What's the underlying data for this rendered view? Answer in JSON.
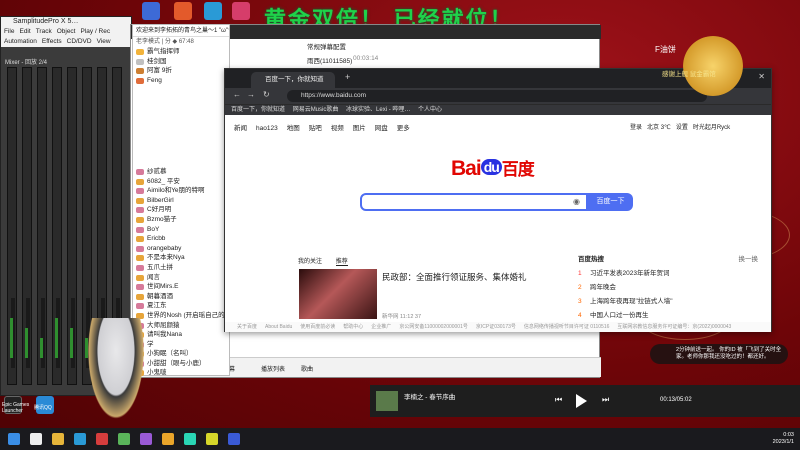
{
  "banner": {
    "text": "黄金双倍！ 已经就位！"
  },
  "daw": {
    "title": "SamplitudePro X 5…",
    "menu": [
      "File",
      "Edit",
      "Track",
      "Object",
      "Play / Rec",
      "Automation",
      "Effects",
      "CD/DVD",
      "View",
      "Ta…"
    ],
    "mixer_label": "Mixer - 回放 2/4"
  },
  "chat": {
    "header": "欢迎来到李拓拓的青鸟之巢～1 \"ω\"♡",
    "count1": "40717173",
    "count2": "457",
    "rank_label": "老李模式 | 分  ◆ 67:48",
    "top": [
      {
        "n": "1",
        "name": "霸气指挥师"
      },
      {
        "n": "2",
        "name": "桂剑国"
      },
      {
        "n": "3",
        "name": "阿富 9折"
      },
      {
        "n": "4",
        "name": "Feng"
      }
    ],
    "users": [
      "纱贰慕",
      "6082_ 平安",
      "Aimilo和Ye朋的特啊",
      "BilberGirl",
      "C好月明",
      "Bzmo猫子",
      "BoY",
      "Ericbb",
      "orangebaby",
      "不是本来Nya",
      "五爪土拼",
      "闻言",
      "世间Mirs.E",
      "朝暮酒酒",
      "夏江东",
      "世界的Nosh (开启瑶自己的)",
      "大师屈颜猿",
      "请叫我Nana",
      "学",
      "小狗眠（名叫）",
      "小甜甜（眼与小鹿）",
      "小鬼啵"
    ]
  },
  "obs": {
    "panel_title": "常规弹幕配置",
    "panel_item": "雨西(11011585)",
    "panel_time": "00:03:14",
    "bottom_items": [
      "帧日弹幕",
      "播放列表",
      "歌曲"
    ]
  },
  "browser": {
    "tab_title": "百度一下，你就知道",
    "url": "https://www.baidu.com",
    "bookmarks": [
      "百度一下，你就知道",
      "网易云Music歌曲",
      "冰球实验、Lexi - 哔哩…",
      "个人中心"
    ],
    "topnav": [
      "新闻",
      "hao123",
      "地图",
      "贴吧",
      "视频",
      "图片",
      "网盘",
      "更多"
    ],
    "topright": [
      "登录",
      "北京",
      "3℃",
      "设置",
      "时光起月Ryck"
    ],
    "logo_bai": "Bai",
    "logo_du": "du",
    "logo_cn": "百度",
    "search_button": "百度一下",
    "feed_tabs": [
      "我的关注",
      "推荐"
    ],
    "feed_title": "民政部：全面推行领证服务、集体婚礼",
    "feed_meta": "新华网  11:12 37",
    "hot_title": "百度热搜",
    "hot_refresh": "换一换",
    "hot": [
      {
        "n": "1",
        "t": "习近平发表2023年新年贺词"
      },
      {
        "n": "2",
        "t": "跨年晚会"
      },
      {
        "n": "3",
        "t": "上海跨年夜再现\"拉链式人墙\""
      },
      {
        "n": "4",
        "t": "中国人口过一份再生"
      }
    ],
    "footer": [
      "关于百度",
      "About Baidu",
      "使用百度前必读",
      "帮助中心",
      "企业推广",
      "京公网安备11000002000001号",
      "京ICP证030173号",
      "信息网络传播视听节目许可证 0110516",
      "互联网宗教信息服务许可证编号：京(2022)0000043"
    ]
  },
  "music": {
    "song": "李楠之 - 春节序曲",
    "time": "00:13/05:02"
  },
  "overlays": {
    "f_you": "F油饼",
    "top_right_caption": "感谢上舰 鼠金霸馆",
    "notif": "2分钟前送一起。 你的ID 被「飞到了关时全家。老师你那我还没吃过的！都还好。"
  },
  "taskbar": {
    "clock_time": "0:03",
    "clock_date": "2023/1/1",
    "desk_labels": [
      "Epic Games Launcher",
      "腾讯QQ",
      "ocQ"
    ]
  },
  "colors": {
    "baidu_blue": "#2932e1",
    "baidu_red": "#e10602",
    "accent": "#4e6ef2",
    "banner": "#1fd24a"
  }
}
